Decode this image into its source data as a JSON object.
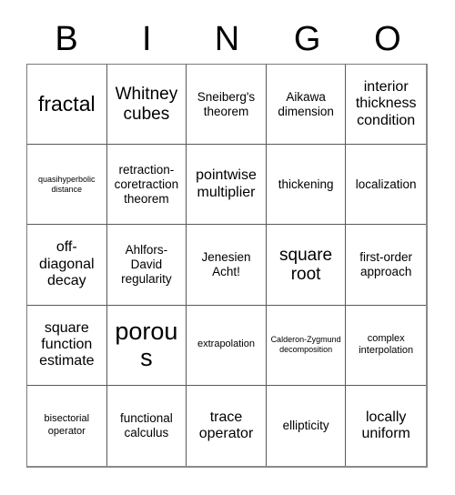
{
  "card": {
    "title": "Bingo Card",
    "header_letters": [
      "B",
      "I",
      "N",
      "G",
      "O"
    ],
    "grid_size": "5x5",
    "border_color": "#595959",
    "background_color": "#ffffff",
    "text_color": "#000000"
  },
  "cells": [
    {
      "row": 1,
      "col": 1,
      "text": "fractal",
      "size": "xxl"
    },
    {
      "row": 1,
      "col": 2,
      "text": "Whitney cubes",
      "size": "xl"
    },
    {
      "row": 1,
      "col": 3,
      "text": "Sneiberg's theorem",
      "size": "m"
    },
    {
      "row": 1,
      "col": 4,
      "text": "Aikawa dimension",
      "size": "m"
    },
    {
      "row": 1,
      "col": 5,
      "text": "interior thickness condition",
      "size": "l"
    },
    {
      "row": 2,
      "col": 1,
      "text": "quasihyperbolic distance",
      "size": "xs"
    },
    {
      "row": 2,
      "col": 2,
      "text": "retraction-coretraction theorem",
      "size": "m"
    },
    {
      "row": 2,
      "col": 3,
      "text": "pointwise multiplier",
      "size": "l"
    },
    {
      "row": 2,
      "col": 4,
      "text": "thickening",
      "size": "m"
    },
    {
      "row": 2,
      "col": 5,
      "text": "localization",
      "size": "m"
    },
    {
      "row": 3,
      "col": 1,
      "text": "off-diagonal decay",
      "size": "l"
    },
    {
      "row": 3,
      "col": 2,
      "text": "Ahlfors-David regularity",
      "size": "m"
    },
    {
      "row": 3,
      "col": 3,
      "text": "Jenesien Acht!",
      "size": "m"
    },
    {
      "row": 3,
      "col": 4,
      "text": "square root",
      "size": "xl"
    },
    {
      "row": 3,
      "col": 5,
      "text": "first-order approach",
      "size": "m"
    },
    {
      "row": 4,
      "col": 1,
      "text": "square function estimate",
      "size": "l"
    },
    {
      "row": 4,
      "col": 2,
      "text": "porous",
      "size": "huge"
    },
    {
      "row": 4,
      "col": 3,
      "text": "extrapolation",
      "size": "s"
    },
    {
      "row": 4,
      "col": 4,
      "text": "Calderon-Zygmund decomposition",
      "size": "xs"
    },
    {
      "row": 4,
      "col": 5,
      "text": "complex interpolation",
      "size": "s"
    },
    {
      "row": 5,
      "col": 1,
      "text": "bisectorial operator",
      "size": "s"
    },
    {
      "row": 5,
      "col": 2,
      "text": "functional calculus",
      "size": "m"
    },
    {
      "row": 5,
      "col": 3,
      "text": "trace operator",
      "size": "l"
    },
    {
      "row": 5,
      "col": 4,
      "text": "ellipticity",
      "size": "m"
    },
    {
      "row": 5,
      "col": 5,
      "text": "locally uniform",
      "size": "l"
    }
  ]
}
